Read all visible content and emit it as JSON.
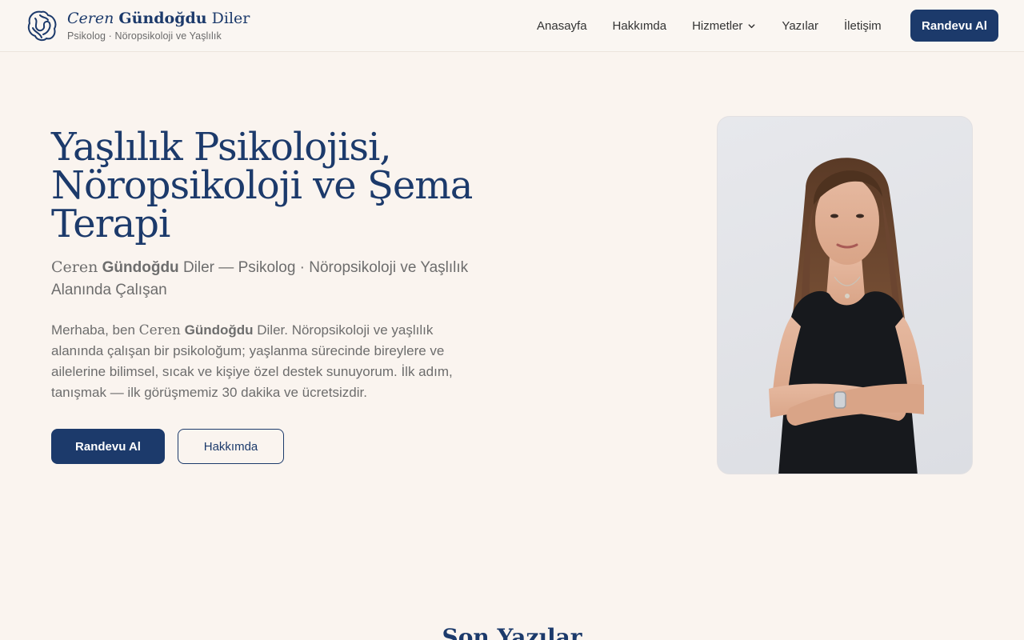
{
  "brand": {
    "first": "Ceren",
    "middle": "Gündoğdu",
    "last": "Diler",
    "tagline": "Psikolog · Nöropsikoloji ve Yaşlılık",
    "logo_icon": "brain-icon"
  },
  "nav": {
    "items": [
      {
        "label": "Anasayfa"
      },
      {
        "label": "Hakkımda"
      },
      {
        "label": "Hizmetler",
        "icon": "chevron-down-icon"
      },
      {
        "label": "Yazılar"
      },
      {
        "label": "İletişim"
      }
    ],
    "cta": "Randevu Al"
  },
  "hero": {
    "title": "Yaşlılık Psikolojisi, Nöropsikoloji ve Şema Terapi",
    "subtitle_first": "Ceren",
    "subtitle_middle": "Gündoğdu",
    "subtitle_rest": "Diler — Psikolog · Nöropsikoloji ve Yaşlılık Alanında Çalışan",
    "body_intro": "Merhaba, ben",
    "body_first": "Ceren",
    "body_middle": "Gündoğdu",
    "body_rest": "Diler. Nöropsikoloji ve yaşlılık alanında çalışan bir psikoloğum; yaşlanma sürecinde bireylere ve ailelerine bilimsel, sıcak ve kişiye özel destek sunuyorum. İlk adım, tanışmak — ilk görüşmemiz 30 dakika ve ücretsizdir.",
    "primary_button": "Randevu Al",
    "secondary_button": "Hakkımda"
  },
  "next_section": {
    "title": "Son Yazılar"
  },
  "colors": {
    "accent": "#1c3a6b",
    "background": "#faf4ef"
  }
}
